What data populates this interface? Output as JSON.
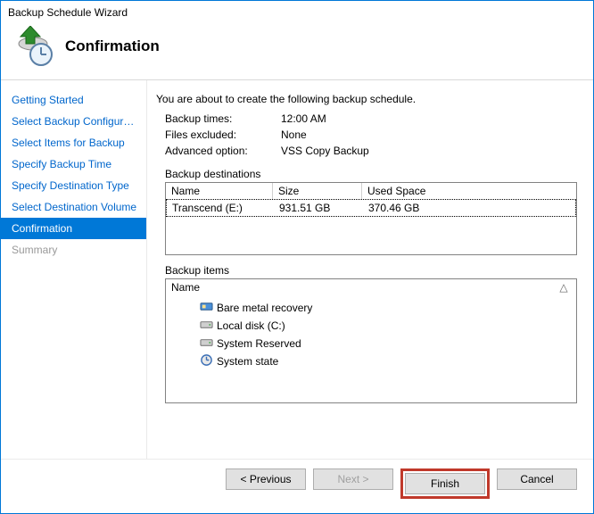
{
  "window": {
    "title": "Backup Schedule Wizard"
  },
  "page": {
    "heading": "Confirmation"
  },
  "steps": [
    {
      "label": "Getting Started",
      "state": "normal"
    },
    {
      "label": "Select Backup Configurat...",
      "state": "normal"
    },
    {
      "label": "Select Items for Backup",
      "state": "normal"
    },
    {
      "label": "Specify Backup Time",
      "state": "normal"
    },
    {
      "label": "Specify Destination Type",
      "state": "normal"
    },
    {
      "label": "Select Destination Volume",
      "state": "normal"
    },
    {
      "label": "Confirmation",
      "state": "active"
    },
    {
      "label": "Summary",
      "state": "disabled"
    }
  ],
  "confirmation": {
    "intro": "You are about to create the following backup schedule.",
    "rows": {
      "backup_times": {
        "label": "Backup times:",
        "value": "12:00 AM"
      },
      "files_excluded": {
        "label": "Files excluded:",
        "value": "None"
      },
      "advanced_option": {
        "label": "Advanced option:",
        "value": "VSS Copy Backup"
      }
    },
    "destinations": {
      "label": "Backup destinations",
      "columns": {
        "name": "Name",
        "size": "Size",
        "used": "Used Space"
      },
      "rows": [
        {
          "name": "Transcend (E:)",
          "size": "931.51 GB",
          "used": "370.46 GB"
        }
      ]
    },
    "items": {
      "label": "Backup items",
      "columns": {
        "name": "Name"
      },
      "rows": [
        {
          "icon": "bare-metal",
          "label": "Bare metal recovery"
        },
        {
          "icon": "disk",
          "label": "Local disk (C:)"
        },
        {
          "icon": "disk",
          "label": "System Reserved"
        },
        {
          "icon": "system-state",
          "label": "System state"
        }
      ]
    }
  },
  "buttons": {
    "previous": "< Previous",
    "next": "Next >",
    "finish": "Finish",
    "cancel": "Cancel"
  }
}
